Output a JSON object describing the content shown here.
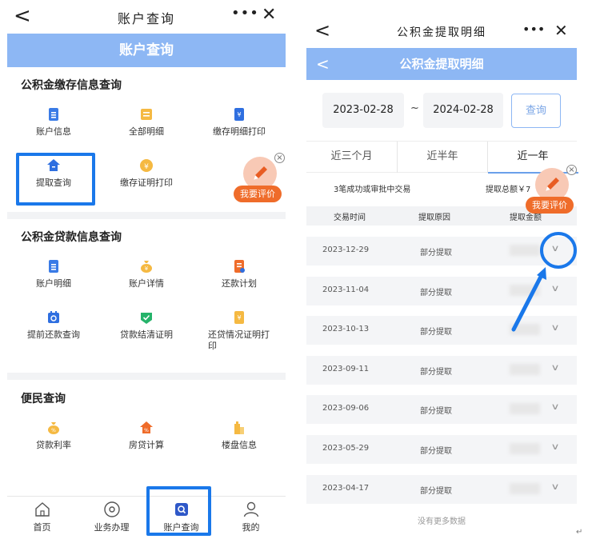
{
  "left": {
    "topbar": {
      "back": "<",
      "title": "账户查询",
      "more": "•••",
      "close": "✕"
    },
    "header": "账户查询",
    "sections": [
      {
        "title": "公积金缴存信息查询",
        "items": [
          {
            "label": "账户信息",
            "icon": "account-info-icon"
          },
          {
            "label": "全部明细",
            "icon": "all-details-icon"
          },
          {
            "label": "缴存明细打印",
            "icon": "deposit-print-icon"
          },
          {
            "label": "提取查询",
            "icon": "withdraw-query-icon"
          },
          {
            "label": "缴存证明打印",
            "icon": "deposit-cert-icon"
          }
        ]
      },
      {
        "title": "公积金贷款信息查询",
        "items": [
          {
            "label": "账户明细",
            "icon": "account-detail-icon"
          },
          {
            "label": "账户详情",
            "icon": "account-more-icon"
          },
          {
            "label": "还款计划",
            "icon": "repay-plan-icon"
          },
          {
            "label": "提前还款查询",
            "icon": "prepay-query-icon"
          },
          {
            "label": "贷款结清证明",
            "icon": "loan-settle-icon"
          },
          {
            "label": "还贷情况证明打印",
            "icon": "repay-cert-icon"
          }
        ]
      },
      {
        "title": "便民查询",
        "items": [
          {
            "label": "贷款利率",
            "icon": "loan-rate-icon"
          },
          {
            "label": "房贷计算",
            "icon": "mortgage-calc-icon"
          },
          {
            "label": "楼盘信息",
            "icon": "building-info-icon"
          }
        ]
      }
    ],
    "rate_button": "我要评价",
    "tabbar": [
      {
        "label": "首页",
        "icon": "home-icon"
      },
      {
        "label": "业务办理",
        "icon": "business-icon"
      },
      {
        "label": "账户查询",
        "icon": "account-query-icon"
      },
      {
        "label": "我的",
        "icon": "profile-icon"
      }
    ]
  },
  "right": {
    "topbar": {
      "back": "<",
      "title": "公积金提取明细",
      "more": "•••",
      "close": "✕"
    },
    "header": "公积金提取明细",
    "header_back": "<",
    "date_start": "2023-02-28",
    "date_sep": "~",
    "date_end": "2024-02-28",
    "query_button": "查询",
    "tabs": [
      "近三个月",
      "近半年",
      "近一年"
    ],
    "active_tab": "近一年",
    "summary_left": "3笔成功或审批中交易",
    "summary_right": "提取总额￥7",
    "table_headers": [
      "交易时间",
      "提取原因",
      "提取金额"
    ],
    "rows": [
      {
        "date": "2023-12-29",
        "reason": "部分提取"
      },
      {
        "date": "2023-11-04",
        "reason": "部分提取"
      },
      {
        "date": "2023-10-13",
        "reason": "部分提取"
      },
      {
        "date": "2023-09-11",
        "reason": "部分提取"
      },
      {
        "date": "2023-09-06",
        "reason": "部分提取"
      },
      {
        "date": "2023-05-29",
        "reason": "部分提取"
      },
      {
        "date": "2023-04-17",
        "reason": "部分提取"
      }
    ],
    "no_more": "没有更多数据",
    "rate_button": "我要评价"
  },
  "colors": {
    "header_blue": "#8db7f4",
    "highlight_blue": "#1a78ea",
    "rate_orange": "#ef6c2a"
  }
}
